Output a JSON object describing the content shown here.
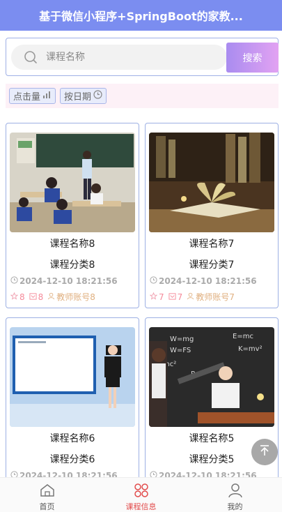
{
  "header": {
    "title": "基于微信小程序+SpringBoot的家教..."
  },
  "search": {
    "placeholder": "课程名称",
    "button_label": "搜索"
  },
  "sort": {
    "by_clicks": "点击量",
    "by_date": "按日期"
  },
  "cards": [
    {
      "title": "课程名称8",
      "category": "课程分类8",
      "date": "2024-12-10 18:21:56",
      "likes": "8",
      "favs": "8",
      "teacher": "教师账号8",
      "image": "classroom"
    },
    {
      "title": "课程名称7",
      "category": "课程分类7",
      "date": "2024-12-10 18:21:56",
      "likes": "7",
      "favs": "7",
      "teacher": "教师账号7",
      "image": "book"
    },
    {
      "title": "课程名称6",
      "category": "课程分类6",
      "date": "2024-12-10 18:21:56",
      "likes": "",
      "favs": "",
      "teacher": "",
      "image": "presenter"
    },
    {
      "title": "课程名称5",
      "category": "课程分类5",
      "date": "2024-12-10 18:21:56",
      "likes": "",
      "favs": "",
      "teacher": "",
      "image": "science"
    }
  ],
  "tabbar": [
    {
      "label": "首页",
      "icon": "home-icon"
    },
    {
      "label": "课程信息",
      "icon": "course-icon",
      "active": true
    },
    {
      "label": "我的",
      "icon": "user-icon"
    }
  ],
  "colors": {
    "header": "#7b8df0",
    "accent": "#e24c4c",
    "button_gradient_start": "#a98cf0",
    "button_gradient_end": "#e2a2f2"
  }
}
